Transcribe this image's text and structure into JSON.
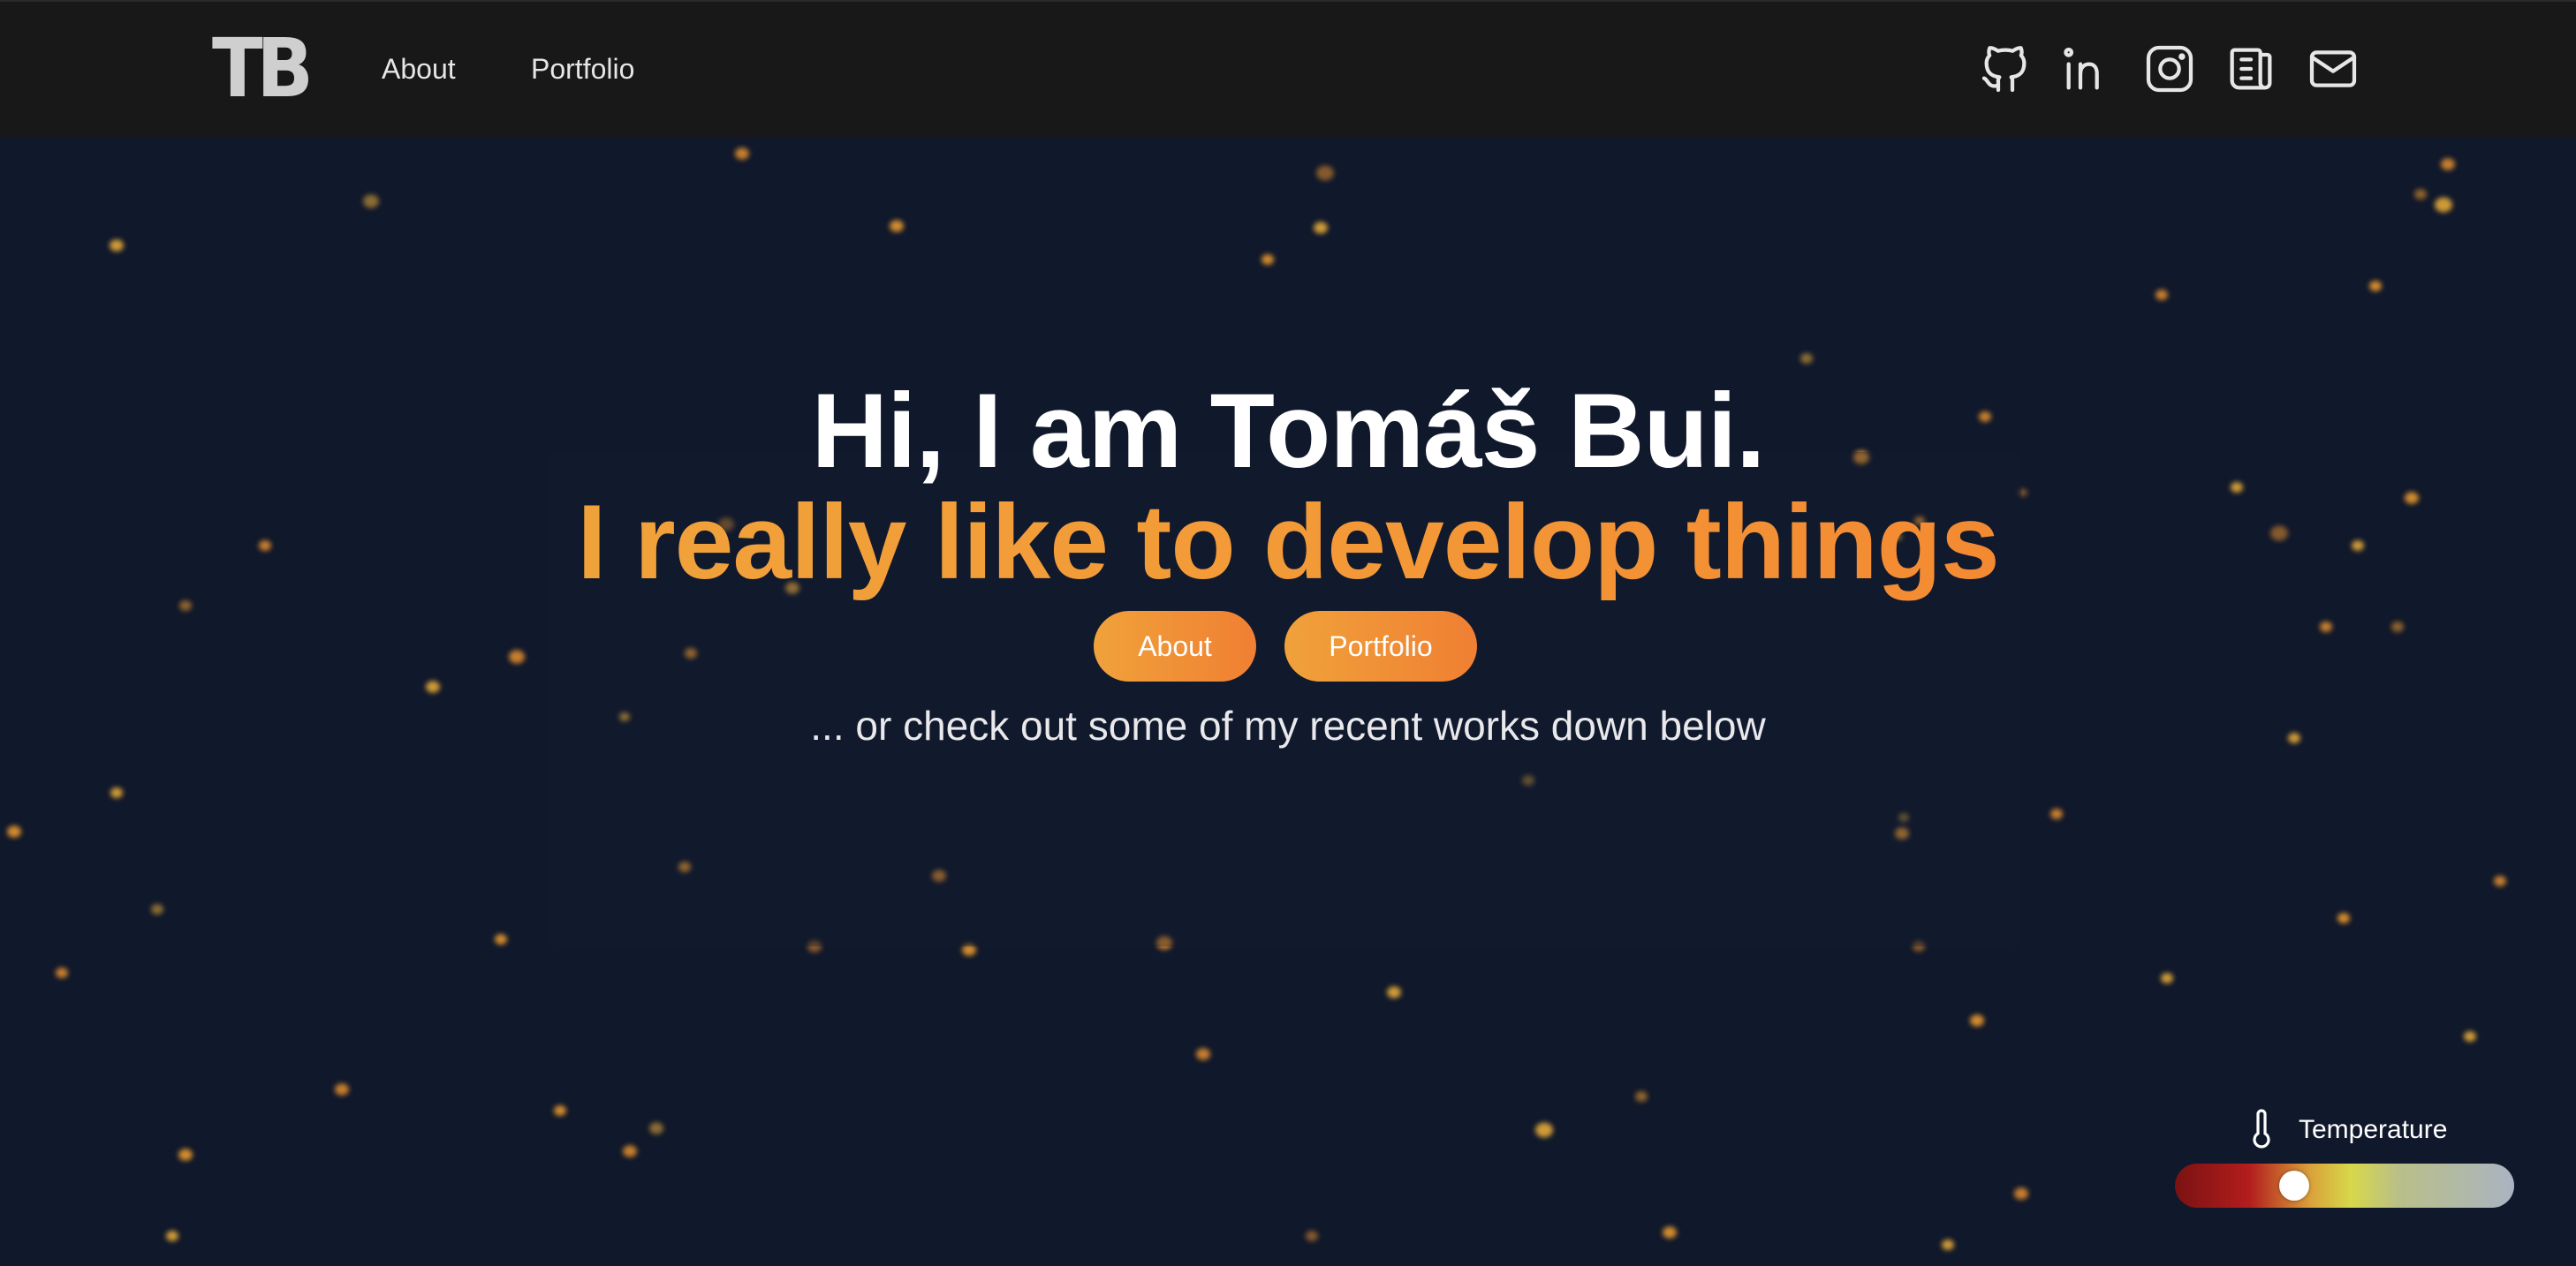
{
  "nav": {
    "logo": "TB",
    "links": [
      {
        "label": "About"
      },
      {
        "label": "Portfolio"
      }
    ],
    "social_icons": [
      "github-icon",
      "linkedin-icon",
      "instagram-icon",
      "newspaper-icon",
      "mail-icon"
    ]
  },
  "hero": {
    "title": "Hi, I am Tomáš Bui.",
    "tagline": "I really like to develop things",
    "buttons": [
      {
        "label": "About"
      },
      {
        "label": "Portfolio"
      }
    ],
    "note": "... or check out some of my recent works down below"
  },
  "temperature": {
    "label": "Temperature",
    "value_fraction": 0.33
  },
  "colors": {
    "accent_start": "#f0a23a",
    "accent_end": "#f07f33",
    "background": "#10182b",
    "navbar": "#181818"
  }
}
